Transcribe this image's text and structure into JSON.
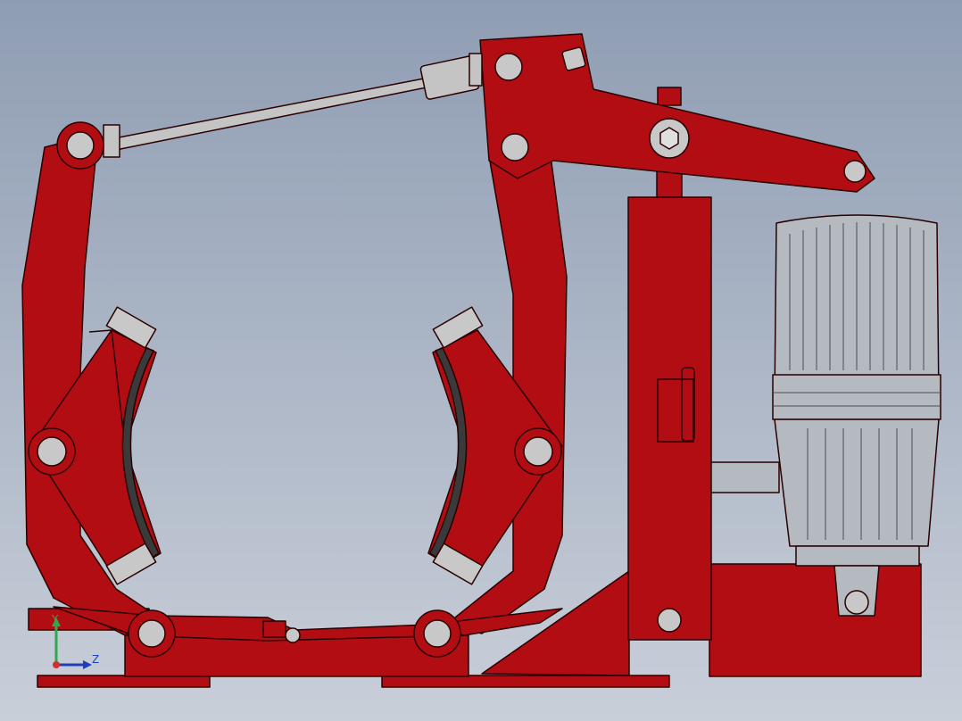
{
  "viewport": {
    "background_top": "#8f9db3",
    "background_bottom": "#c9cfd9"
  },
  "colors": {
    "frame_red": "#b30d14",
    "frame_red_dark": "#8a080d",
    "pin_gray": "#c8c8c8",
    "rod_gray": "#c4c4c4",
    "motor_gray": "#b4bac0",
    "lining_dark": "#3a3a3a",
    "outline": "#2a0000"
  },
  "triad": {
    "y_label": "Y",
    "z_label": "Z",
    "y_color": "#2fa84f",
    "z_color": "#1f3fb8",
    "origin_color": "#d23030"
  }
}
